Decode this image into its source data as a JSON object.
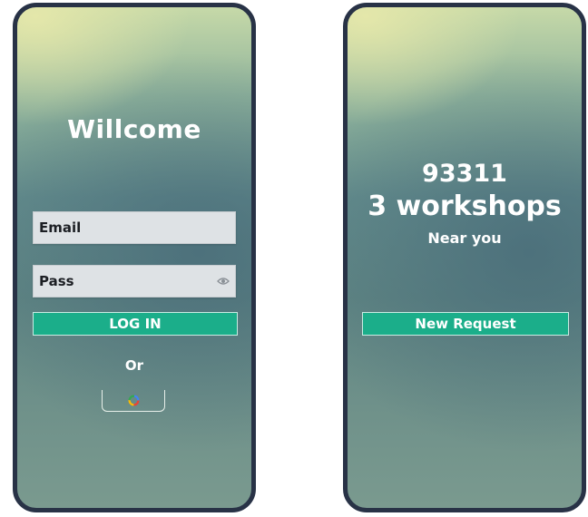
{
  "login_screen": {
    "title": "Willcome",
    "email_label": "Email",
    "password_label": "Pass",
    "login_button": "LOG IN",
    "or_text": "Or"
  },
  "results_screen": {
    "zip_code": "93311",
    "workshops_count": "3 workshops",
    "near_you": "Near you",
    "new_request_button": "New Request"
  },
  "colors": {
    "accent_green": "#1bae8a",
    "phone_frame": "#283246",
    "field_background": "#dee2e5"
  },
  "icons": [
    "eye-icon",
    "google-icon"
  ]
}
